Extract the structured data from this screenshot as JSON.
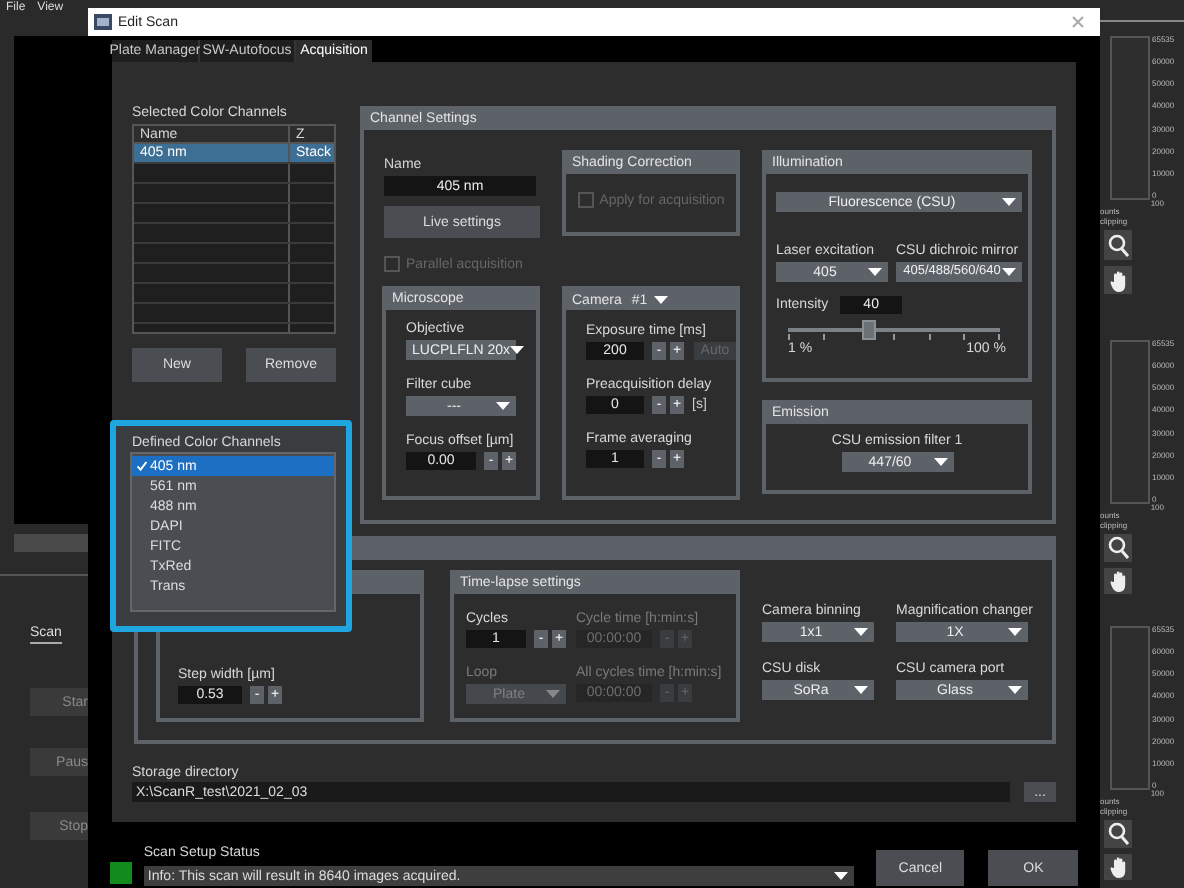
{
  "menu_bar": [
    "File",
    "View"
  ],
  "main_window": {
    "scan_section": {
      "title": "Scan",
      "buttons": [
        "Star",
        "Paus",
        "Stop"
      ]
    },
    "histograms": [
      {
        "scale": [
          "65535",
          "60000",
          "50000",
          "40000",
          "30000",
          "20000",
          "10000",
          "0"
        ],
        "max": "100",
        "counts": "ounts",
        "clipping": "clipping"
      },
      {
        "scale": [
          "65535",
          "60000",
          "50000",
          "40000",
          "30000",
          "20000",
          "10000",
          "0"
        ],
        "max": "100",
        "counts": "ounts",
        "clipping": "clipping"
      },
      {
        "scale": [
          "65535",
          "60000",
          "50000",
          "40000",
          "30000",
          "20000",
          "10000",
          "0"
        ],
        "max": "100",
        "counts": "ounts",
        "clipping": "clipping"
      }
    ]
  },
  "dialog": {
    "title": "Edit Scan",
    "tabs": [
      {
        "label": "Plate Manager",
        "selected": false
      },
      {
        "label": "SW-Autofocus",
        "selected": false
      },
      {
        "label": "Acquisition",
        "selected": true
      }
    ],
    "selected_channels": {
      "title": "Selected Color Channels",
      "columns": [
        "Name",
        "Z"
      ],
      "rows": [
        {
          "cells": [
            "405 nm",
            "Stack"
          ],
          "selected": true
        }
      ],
      "buttons": [
        "New",
        "Remove"
      ]
    },
    "channel_settings": {
      "title": "Channel Settings",
      "name": {
        "label": "Name",
        "value": "405 nm"
      },
      "live_button": "Live settings",
      "parallel": {
        "label": "Parallel acquisition",
        "checked": false,
        "disabled": true
      },
      "shading": {
        "title": "Shading Correction",
        "checkbox": {
          "label": "Apply for acquisition",
          "checked": false,
          "disabled": true
        }
      },
      "illumination": {
        "title": "Illumination",
        "mode": "Fluorescence (CSU)",
        "laser": {
          "label": "Laser excitation",
          "value": "405"
        },
        "mirror": {
          "label": "CSU dichroic mirror",
          "value": "405/488/560/640"
        },
        "intensity": {
          "label": "Intensity",
          "value": "40",
          "level": 0.38,
          "min": "1 %",
          "max": "100 %"
        }
      },
      "microscope": {
        "title": "Microscope",
        "objective": {
          "label": "Objective",
          "value": "LUCPLFLN 20x"
        },
        "filter": {
          "label": "Filter cube",
          "value": "---"
        },
        "focus": {
          "label": "Focus offset [µm]",
          "value": "0.00",
          "steppers": [
            "-",
            "+"
          ]
        }
      },
      "camera": {
        "title": "Camera",
        "number": "#1",
        "exposure": {
          "label": "Exposure time [ms]",
          "value": "200",
          "steppers": [
            "-",
            "+"
          ],
          "auto": {
            "label": "Auto",
            "disabled": true
          }
        },
        "delay": {
          "label": "Preacquisition delay",
          "value": "0",
          "steppers": [
            "-",
            "+"
          ],
          "unit": "[s]"
        },
        "averaging": {
          "label": "Frame averaging",
          "value": "1",
          "steppers": [
            "-",
            "+"
          ]
        }
      },
      "emission": {
        "title": "Emission",
        "filter": {
          "label": "CSU emission filter 1",
          "value": "447/60"
        }
      }
    },
    "scan_settings": {
      "z_stack": {
        "step": {
          "label": "Step width [µm]",
          "value": "0.53",
          "steppers": [
            "-",
            "+"
          ]
        }
      },
      "time_lapse": {
        "title": "Time-lapse settings",
        "fields": [
          {
            "kind": "spin",
            "label": "Cycles",
            "value": "1",
            "disabled": false,
            "steppers": [
              "-",
              "+"
            ]
          },
          {
            "kind": "spin",
            "label": "Cycle time [h:min:s]",
            "value": "00:00:00",
            "disabled": true,
            "steppers": [
              "-",
              "+"
            ]
          },
          {
            "kind": "dropdown",
            "label": "Loop",
            "value": "Plate",
            "disabled": true
          },
          {
            "kind": "spin",
            "label": "All cycles time [h:min:s]",
            "value": "00:00:00",
            "disabled": true,
            "steppers": [
              "-",
              "+"
            ]
          }
        ]
      },
      "options": [
        {
          "label": "Camera binning",
          "value": "1x1"
        },
        {
          "label": "Magnification changer",
          "value": "1X"
        },
        {
          "label": "CSU disk",
          "value": "SoRa"
        },
        {
          "label": "CSU camera port",
          "value": "Glass"
        }
      ]
    },
    "storage": {
      "label": "Storage directory",
      "value": "X:\\ScanR_test\\2021_02_03",
      "browse": "..."
    },
    "status": {
      "label": "Scan Setup Status",
      "message": "Info: This scan will result in 8640 images acquired."
    },
    "buttons": [
      "Cancel",
      "OK"
    ],
    "channel_dropdown": {
      "title": "Defined Color Channels",
      "items": [
        {
          "label": "405 nm",
          "selected": true
        },
        {
          "label": "561 nm",
          "selected": false
        },
        {
          "label": "488 nm",
          "selected": false
        },
        {
          "label": "DAPI",
          "selected": false
        },
        {
          "label": "FITC",
          "selected": false
        },
        {
          "label": "TxRed",
          "selected": false
        },
        {
          "label": "Trans",
          "selected": false
        }
      ]
    }
  }
}
